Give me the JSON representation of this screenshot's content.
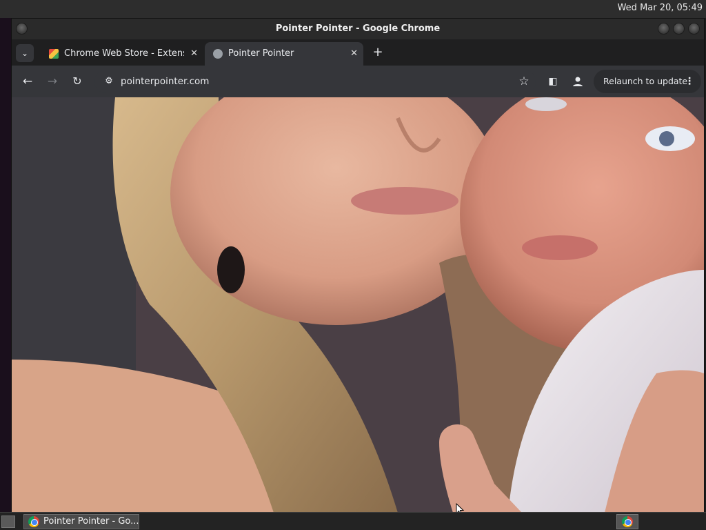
{
  "system_bar": {
    "clock": "Wed Mar 20, 05:49"
  },
  "window": {
    "title": "Pointer Pointer - Google Chrome"
  },
  "tabs": [
    {
      "label": "Chrome Web Store - Extensions",
      "favicon": "chrome-web-store-icon",
      "active": false
    },
    {
      "label": "Pointer Pointer",
      "favicon": "globe-icon",
      "active": true
    }
  ],
  "toolbar": {
    "url": "pointerpointer.com",
    "relaunch_label": "Relaunch to update",
    "icons": [
      "back-arrow-icon",
      "forward-arrow-icon",
      "reload-icon",
      "site-info-icon",
      "bookmark-star-icon",
      "side-panel-icon",
      "profile-icon",
      "more-vert-icon"
    ]
  },
  "taskbar": {
    "task_label": "Pointer Pointer - Go..."
  },
  "colors": {
    "chrome_dark": "#35363a",
    "tabstrip": "#1f1f20",
    "titlebar": "#2a2a2a"
  }
}
